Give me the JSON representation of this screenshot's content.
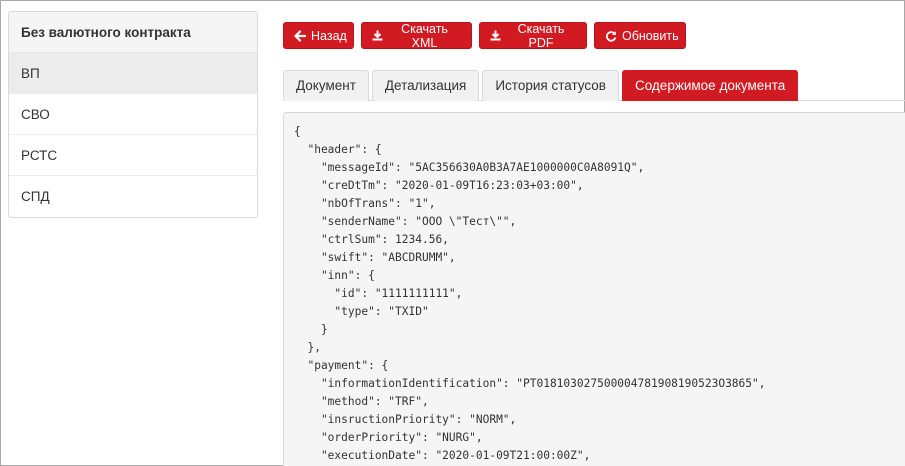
{
  "sidebar": {
    "header": "Без валютного контракта",
    "items": [
      {
        "label": "ВП",
        "active": true
      },
      {
        "label": "СВО",
        "active": false
      },
      {
        "label": "РСТС",
        "active": false
      },
      {
        "label": "СПД",
        "active": false
      }
    ]
  },
  "toolbar": {
    "back_label": "Назад",
    "download_xml_label": "Скачать XML",
    "download_pdf_label": "Скачать PDF",
    "refresh_label": "Обновить",
    "accent_color": "#d21a22"
  },
  "tabs": [
    {
      "label": "Документ",
      "active": false
    },
    {
      "label": "Детализация",
      "active": false
    },
    {
      "label": "История статусов",
      "active": false
    },
    {
      "label": "Содержимое документа",
      "active": true
    }
  ],
  "document_content": {
    "lines": [
      "{",
      "  \"header\": {",
      "    \"messageId\": \"5AC356630A0B3A7AE1000000C0A8091Q\",",
      "    \"creDtTm\": \"2020-01-09T16:23:03+03:00\",",
      "    \"nbOfTrans\": \"1\",",
      "    \"senderName\": \"ООО \\\"Тест\\\"\",",
      "    \"ctrlSum\": 1234.56,",
      "    \"swift\": \"ABCDRUMM\",",
      "    \"inn\": {",
      "      \"id\": \"1111111111\",",
      "      \"type\": \"TXID\"",
      "    }",
      "  },",
      "  \"payment\": {",
      "    \"informationIdentification\": \"PT018103027500004781908190523O3865\",",
      "    \"method\": \"TRF\",",
      "    \"insructionPriority\": \"NORM\",",
      "    \"orderPriority\": \"NURG\",",
      "    \"executionDate\": \"2020-01-09T21:00:00Z\","
    ]
  }
}
